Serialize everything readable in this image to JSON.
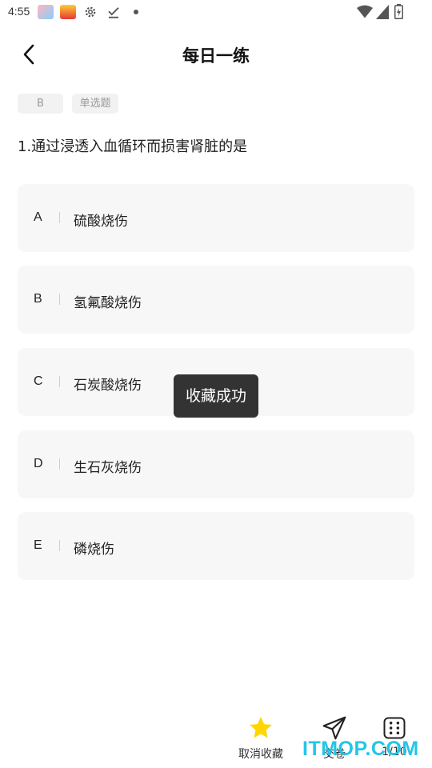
{
  "status_bar": {
    "time": "4:55"
  },
  "header": {
    "title": "每日一练"
  },
  "question": {
    "answer_tag": "B",
    "type_tag": "单选题",
    "text": "1.通过浸透入血循环而损害肾脏的是"
  },
  "options": [
    {
      "letter": "A",
      "text": "硫酸烧伤"
    },
    {
      "letter": "B",
      "text": "氢氟酸烧伤"
    },
    {
      "letter": "C",
      "text": "石炭酸烧伤"
    },
    {
      "letter": "D",
      "text": "生石灰烧伤"
    },
    {
      "letter": "E",
      "text": "磷烧伤"
    }
  ],
  "toast": {
    "text": "收藏成功"
  },
  "bottom_bar": {
    "favorite_label": "取消收藏",
    "submit_label": "交卷",
    "progress_label": "1/10",
    "favorite_color": "#ffd600"
  },
  "watermark": {
    "text": "ITMOP.COM"
  }
}
